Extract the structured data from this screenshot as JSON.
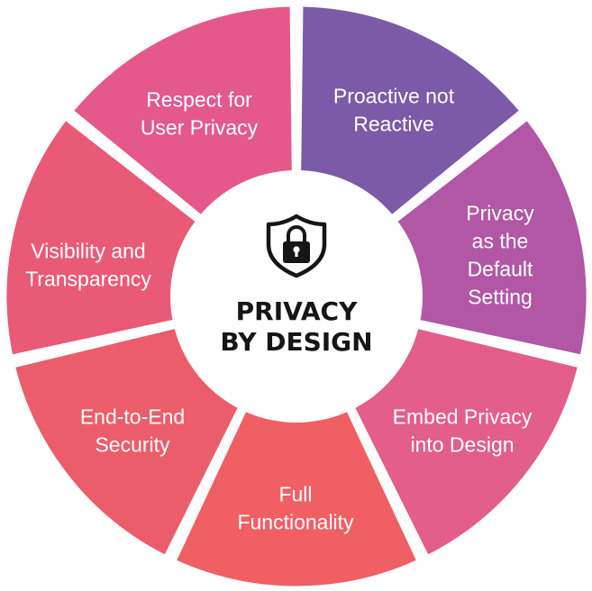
{
  "center": {
    "title_line1": "PRIVACY",
    "title_line2": "BY DESIGN",
    "icon": "shield-lock-icon"
  },
  "segments": [
    {
      "id": "proactive",
      "lines": [
        "Proactive not",
        "Reactive"
      ],
      "color": "#7B5AA8"
    },
    {
      "id": "default-setting",
      "lines": [
        "Privacy",
        "as the",
        "Default",
        "Setting"
      ],
      "color": "#B157A5"
    },
    {
      "id": "embed-privacy",
      "lines": [
        "Embed Privacy",
        "into Design"
      ],
      "color": "#E35E8A"
    },
    {
      "id": "full-functionality",
      "lines": [
        "Full",
        "Functionality"
      ],
      "color": "#EF5F64"
    },
    {
      "id": "end-to-end",
      "lines": [
        "End-to-End",
        "Security"
      ],
      "color": "#EB5D6A"
    },
    {
      "id": "visibility",
      "lines": [
        "Visibility and",
        "Transparency"
      ],
      "color": "#E95A76"
    },
    {
      "id": "respect",
      "lines": [
        "Respect for",
        "User Privacy"
      ],
      "color": "#E4588A"
    }
  ]
}
